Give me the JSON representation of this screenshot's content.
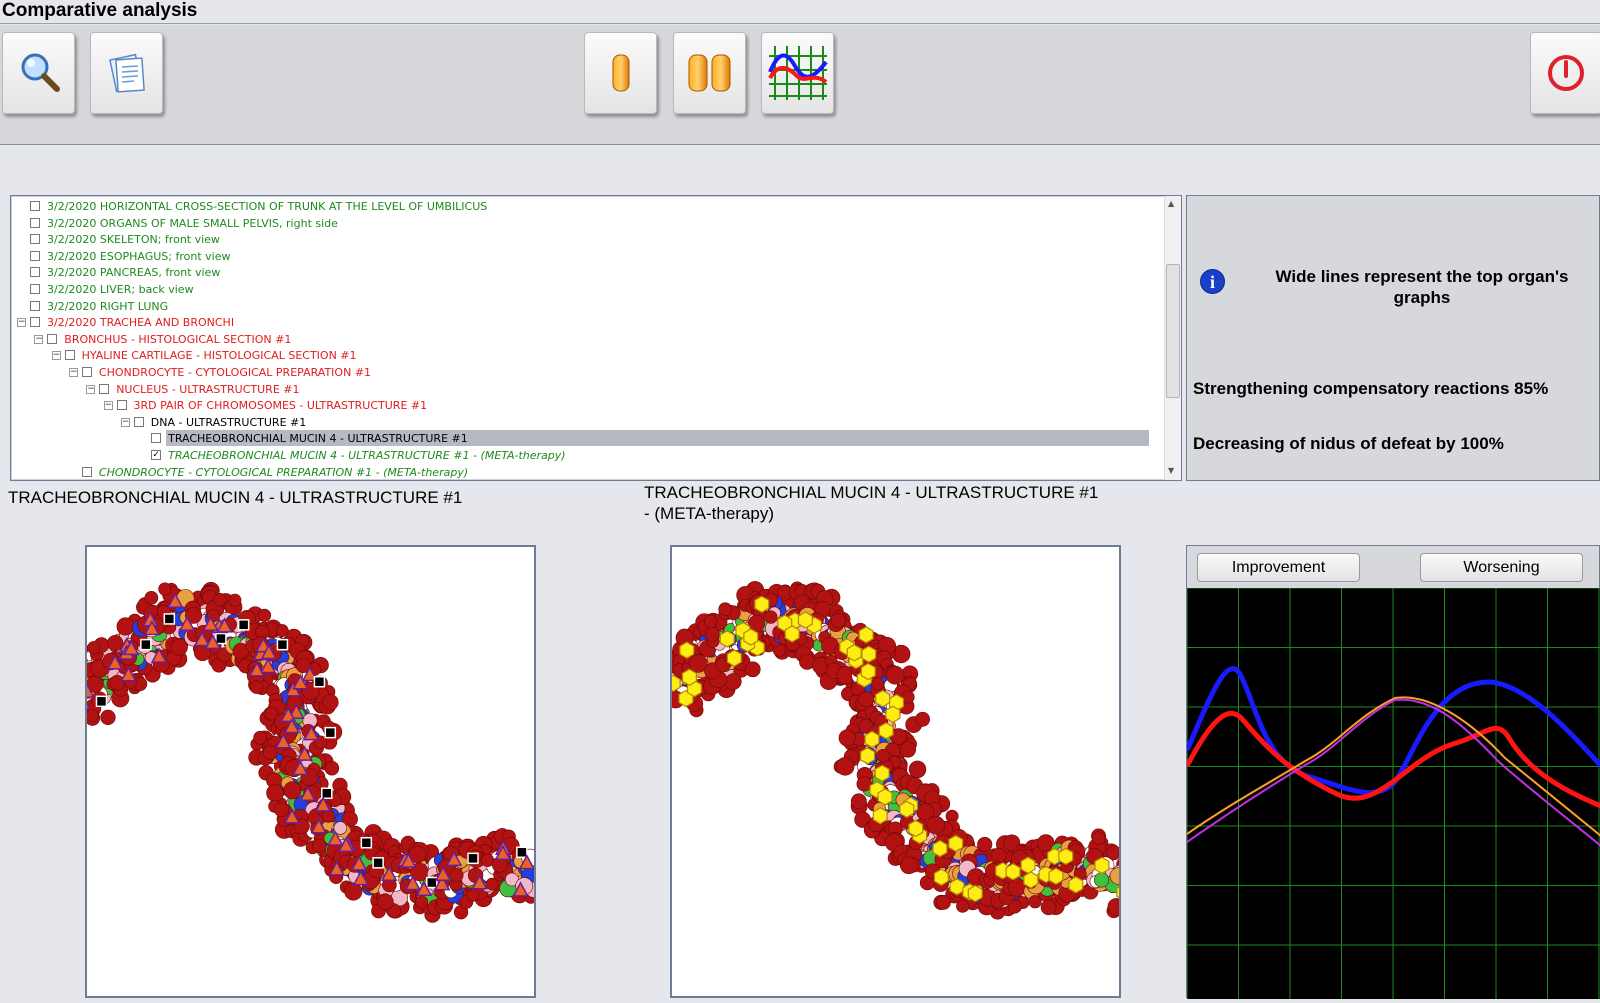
{
  "window": {
    "title": "Comparative analysis"
  },
  "toolbar": {
    "buttons": [
      {
        "name": "search-button",
        "icon": "magnifier-icon"
      },
      {
        "name": "report-button",
        "icon": "clipboard-icon"
      },
      {
        "name": "single-view-button",
        "icon": "single-capsule-icon"
      },
      {
        "name": "double-view-button",
        "icon": "double-capsule-icon"
      },
      {
        "name": "graph-button",
        "icon": "graph-icon"
      },
      {
        "name": "exit-button",
        "icon": "power-icon"
      }
    ]
  },
  "tree": {
    "rows": [
      {
        "date": "3/2/2020",
        "label": "HORIZONTAL CROSS-SECTION OF TRUNK AT THE LEVEL OF UMBILICUS",
        "color": "green",
        "indent": 0,
        "expander": false,
        "checked": false
      },
      {
        "date": "3/2/2020",
        "label": "ORGANS OF MALE SMALL PELVIS, right side",
        "color": "green",
        "indent": 0,
        "expander": false,
        "checked": false
      },
      {
        "date": "3/2/2020",
        "label": "SKELETON; front view",
        "color": "green",
        "indent": 0,
        "expander": false,
        "checked": false
      },
      {
        "date": "3/2/2020",
        "label": "ESOPHAGUS; front view",
        "color": "green",
        "indent": 0,
        "expander": false,
        "checked": false
      },
      {
        "date": "3/2/2020",
        "label": "PANCREAS,  front  view",
        "color": "green",
        "indent": 0,
        "expander": false,
        "checked": false
      },
      {
        "date": "3/2/2020",
        "label": "LIVER; back view",
        "color": "green",
        "indent": 0,
        "expander": false,
        "checked": false
      },
      {
        "date": "3/2/2020",
        "label": "RIGHT  LUNG",
        "color": "green",
        "indent": 0,
        "expander": false,
        "checked": false
      },
      {
        "date": "3/2/2020",
        "label": "TRACHEA  AND  BRONCHI",
        "color": "red",
        "indent": 0,
        "expander": true,
        "checked": false
      },
      {
        "date": "",
        "label": "BRONCHUS - HISTOLOGICAL SECTION #1",
        "color": "red",
        "indent": 1,
        "expander": true,
        "checked": false
      },
      {
        "date": "",
        "label": "HYALINE CARTILAGE - HISTOLOGICAL SECTION #1",
        "color": "red",
        "indent": 2,
        "expander": true,
        "checked": false
      },
      {
        "date": "",
        "label": "CHONDROCYTE - CYTOLOGICAL PREPARATION #1",
        "color": "red",
        "indent": 3,
        "expander": true,
        "checked": false
      },
      {
        "date": "",
        "label": "NUCLEUS - ULTRASTRUCTURE #1",
        "color": "red",
        "indent": 4,
        "expander": true,
        "checked": false
      },
      {
        "date": "",
        "label": "3RD PAIR OF CHROMOSOMES - ULTRASTRUCTURE #1",
        "color": "red",
        "indent": 5,
        "expander": true,
        "checked": false
      },
      {
        "date": "",
        "label": "DNA - ULTRASTRUCTURE #1",
        "color": "black",
        "indent": 6,
        "expander": true,
        "checked": false
      },
      {
        "date": "",
        "label": "TRACHEOBRONCHIAL MUCIN 4 - ULTRASTRUCTURE #1",
        "color": "black",
        "indent": 7,
        "expander": false,
        "checked": false,
        "selected": true
      },
      {
        "date": "",
        "label": "TRACHEOBRONCHIAL MUCIN 4 - ULTRASTRUCTURE #1 - (META-therapy)",
        "color": "green",
        "indent": 7,
        "expander": false,
        "checked": true,
        "italic": true
      },
      {
        "date": "",
        "label": "CHONDROCYTE - CYTOLOGICAL PREPARATION #1 - (META-therapy)",
        "color": "green",
        "indent": 3,
        "expander": false,
        "checked": false,
        "italic": true
      }
    ]
  },
  "info": {
    "note": "Wide lines represent the top organ's graphs",
    "icon": "info-icon",
    "metric1": "Strengthening compensatory reactions 85%",
    "metric2": "Decreasing of nidus of defeat by 100%"
  },
  "captions": {
    "left": "TRACHEOBRONCHIAL MUCIN 4 - ULTRASTRUCTURE #1",
    "right": "TRACHEOBRONCHIAL MUCIN 4 - ULTRASTRUCTURE #1 - (META-therapy)"
  },
  "chart": {
    "improvement_label": "Improvement",
    "worsening_label": "Worsening"
  },
  "colors": {
    "grid": "#1a8a1a",
    "blue": "#1a1aff",
    "red": "#ff1414",
    "orange": "#ffa024",
    "violet": "#c030e0"
  }
}
